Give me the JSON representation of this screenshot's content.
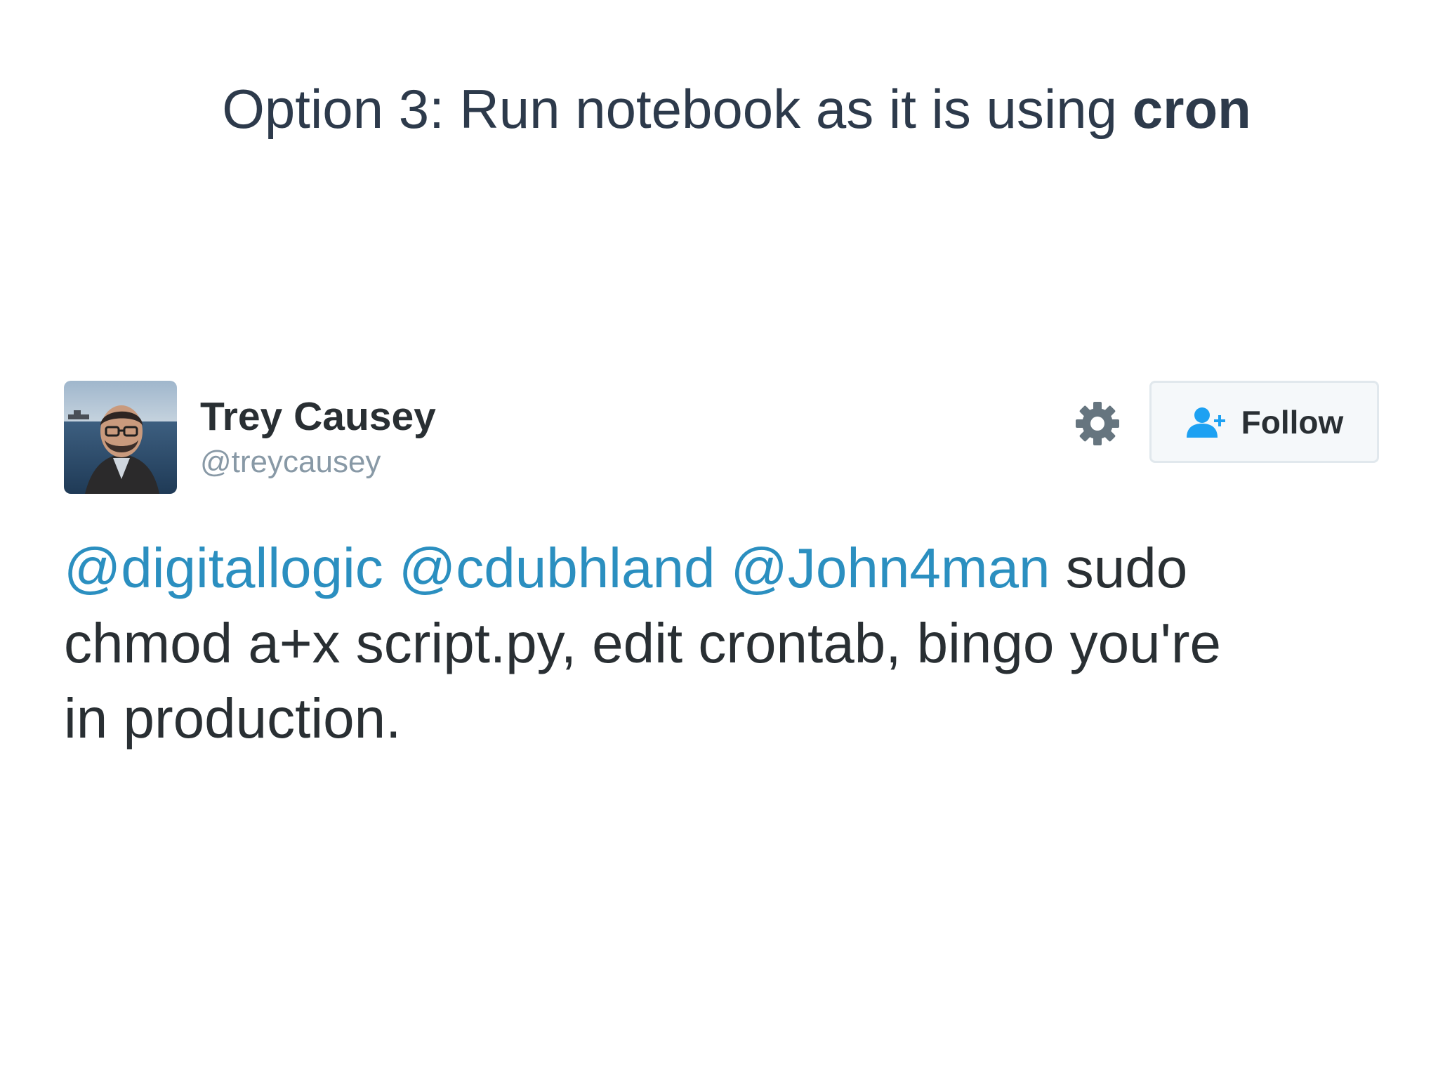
{
  "slide": {
    "title_prefix": "Option 3: Run notebook as it is using ",
    "title_emphasis": "cron"
  },
  "tweet": {
    "display_name": "Trey Causey",
    "handle": "@treycausey",
    "follow_label": "Follow",
    "mentions": [
      "@digitallogic",
      "@cdubhland",
      "@John4man"
    ],
    "text_line1_rest": " sudo",
    "text_line2": "chmod a+x script.py, edit crontab, bingo you're",
    "text_line3": "in production.",
    "colors": {
      "mention": "#2b8fc0",
      "text": "#292f33",
      "handle": "#8899a6",
      "follow_icon": "#1da1f2"
    },
    "icons": {
      "settings": "gear-icon",
      "follow": "add-user-icon"
    }
  }
}
